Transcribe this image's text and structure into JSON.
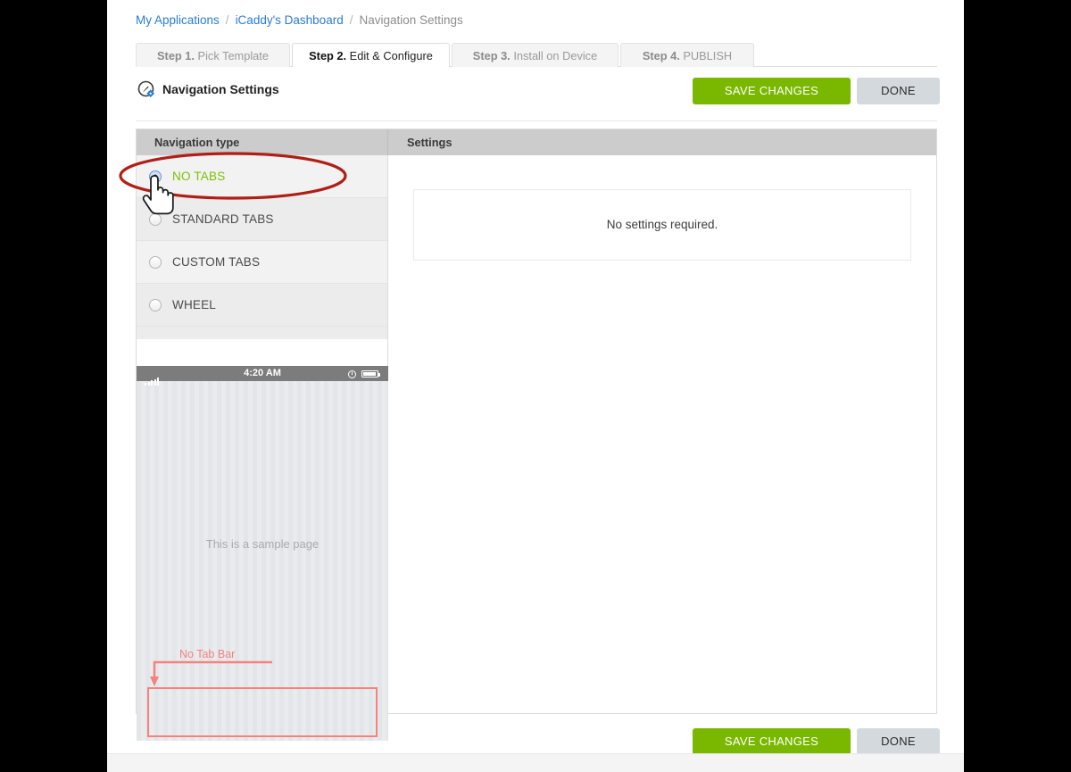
{
  "breadcrumb": {
    "items": [
      {
        "label": "My Applications",
        "type": "link"
      },
      {
        "label": "iCaddy's Dashboard",
        "type": "link"
      },
      {
        "label": "Navigation Settings",
        "type": "current"
      }
    ],
    "separator": "/"
  },
  "steps": [
    {
      "num": "Step 1.",
      "label": "Pick Template",
      "active": false
    },
    {
      "num": "Step 2.",
      "label": "Edit & Configure",
      "active": true
    },
    {
      "num": "Step 3.",
      "label": "Install on Device",
      "active": false
    },
    {
      "num": "Step 4.",
      "label": "PUBLISH",
      "active": false
    }
  ],
  "header": {
    "icon": "compass-gear-icon",
    "title": "Navigation Settings",
    "save_label": "SAVE CHANGES",
    "done_label": "DONE"
  },
  "panel": {
    "col_nav_header": "Navigation type",
    "col_settings_header": "Settings",
    "options": [
      {
        "label": "NO TABS",
        "selected": true
      },
      {
        "label": "STANDARD TABS",
        "selected": false
      },
      {
        "label": "CUSTOM TABS",
        "selected": false
      },
      {
        "label": "WHEEL",
        "selected": false
      }
    ],
    "settings_message": "No settings required."
  },
  "preview": {
    "status_time": "4:20 AM",
    "sample_text": "This is a sample page",
    "annotation_label": "No Tab Bar"
  },
  "footer": {
    "save_label": "SAVE CHANGES",
    "done_label": "DONE"
  },
  "colors": {
    "accent_green": "#7ab800",
    "selected_label_green": "#7ac100",
    "link_blue": "#2b7cd3",
    "annotation_red": "#f4827f",
    "highlight_ellipse": "#b01f16",
    "done_gray": "#d4d9dd"
  }
}
